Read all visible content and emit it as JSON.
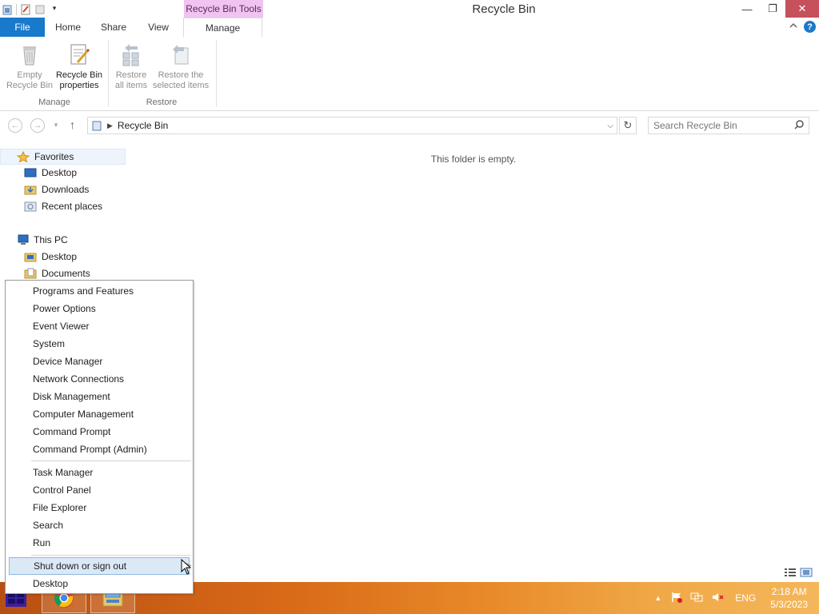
{
  "window": {
    "title": "Recycle Bin",
    "contextual_tab_header": "Recycle Bin Tools",
    "minimize": "—",
    "restore": "❐",
    "close": "✕"
  },
  "ribbon": {
    "tabs": [
      "File",
      "Home",
      "Share",
      "View",
      "Manage"
    ],
    "help": "?",
    "groups": {
      "manage": {
        "label": "Manage",
        "empty_line1": "Empty",
        "empty_line2": "Recycle Bin",
        "props_line1": "Recycle Bin",
        "props_line2": "properties"
      },
      "restore": {
        "label": "Restore",
        "all_line1": "Restore",
        "all_line2": "all items",
        "sel_line1": "Restore the",
        "sel_line2": "selected items"
      }
    }
  },
  "address": {
    "path": "Recycle Bin",
    "search_placeholder": "Search Recycle Bin"
  },
  "navpane": {
    "favorites": "Favorites",
    "favorites_items": [
      "Desktop",
      "Downloads",
      "Recent places"
    ],
    "this_pc": "This PC",
    "pc_items": [
      "Desktop",
      "Documents"
    ]
  },
  "content": {
    "empty_message": "This folder is empty."
  },
  "power_menu": {
    "group1": [
      "Programs and Features",
      "Power Options",
      "Event Viewer",
      "System",
      "Device Manager",
      "Network Connections",
      "Disk Management",
      "Computer Management",
      "Command Prompt",
      "Command Prompt (Admin)"
    ],
    "group2": [
      "Task Manager",
      "Control Panel",
      "File Explorer",
      "Search",
      "Run"
    ],
    "group3": [
      "Shut down or sign out",
      "Desktop"
    ],
    "highlighted": "Shut down or sign out"
  },
  "taskbar": {
    "language": "ENG",
    "time": "2:18 AM",
    "date": "5/3/2023"
  },
  "colors": {
    "file_tab": "#1979ca",
    "contextual_tab": "#f0c3f0",
    "close_button": "#c7505d",
    "taskbar_start": "#b84f12",
    "taskbar_end": "#f4b75a",
    "menu_highlight": "#dbe9f7"
  }
}
